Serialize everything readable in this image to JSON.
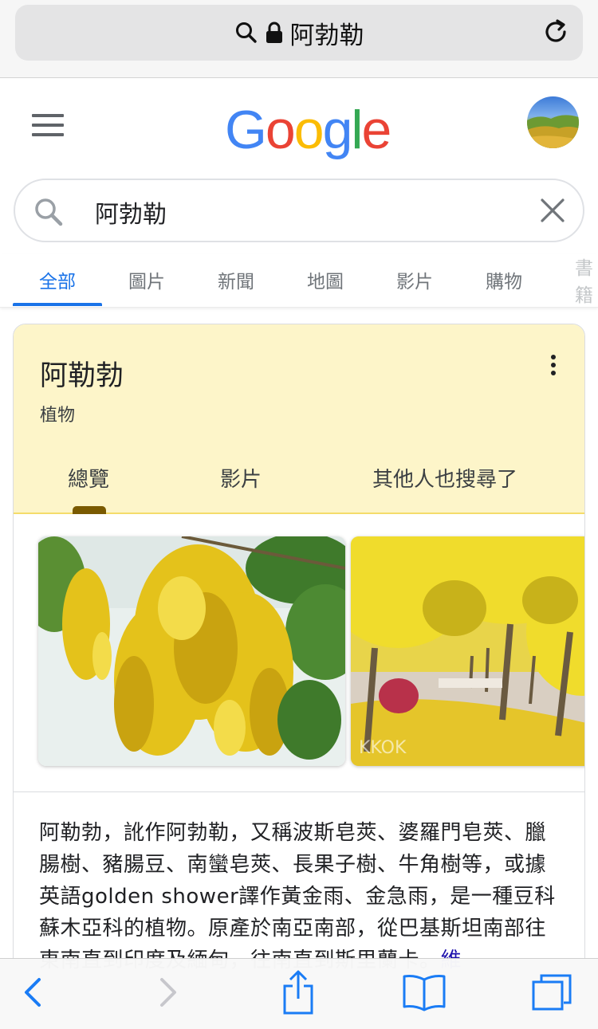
{
  "browser": {
    "address_text": "阿勃勒",
    "icons": [
      "search-icon",
      "lock-icon",
      "reload-icon"
    ]
  },
  "header": {
    "logo_letters": [
      {
        "ch": "G",
        "color": "#4285F4"
      },
      {
        "ch": "o",
        "color": "#EA4335"
      },
      {
        "ch": "o",
        "color": "#FBBC05"
      },
      {
        "ch": "g",
        "color": "#4285F4"
      },
      {
        "ch": "l",
        "color": "#34A853"
      },
      {
        "ch": "e",
        "color": "#EA4335"
      }
    ]
  },
  "search": {
    "query": "阿勃勒"
  },
  "tabs": [
    {
      "label": "全部",
      "active": true
    },
    {
      "label": "圖片"
    },
    {
      "label": "新聞"
    },
    {
      "label": "地圖"
    },
    {
      "label": "影片"
    },
    {
      "label": "購物"
    },
    {
      "label": "書籍"
    }
  ],
  "card": {
    "title": "阿勒勃",
    "subtitle": "植物",
    "tabs": [
      "總覽",
      "影片",
      "其他人也搜尋了"
    ],
    "active_tab": "總覽",
    "image_watermark": "KKOK",
    "description": "阿勒勃，訛作阿勃勒，又稱波斯皂莢、婆羅門皂莢、臘腸樹、豬腸豆、南蠻皂莢、長果子樹、牛角樹等，或據英語golden shower譯作黃金雨、金急雨，是一種豆科蘇木亞科的植物。原產於南亞南部，從巴基斯坦南部往東南直到印度及緬甸，往南直到斯里蘭卡。",
    "more_link": "維"
  },
  "toolbar": {
    "icons": [
      "back-icon",
      "forward-icon",
      "share-icon",
      "bookmarks-icon",
      "tabs-icon"
    ]
  },
  "colors": {
    "accent": "#1a73e8",
    "card_header_bg": "#fdf5c9",
    "card_header_border": "#f5dc6a",
    "ios_blue": "#1a7cf5"
  }
}
